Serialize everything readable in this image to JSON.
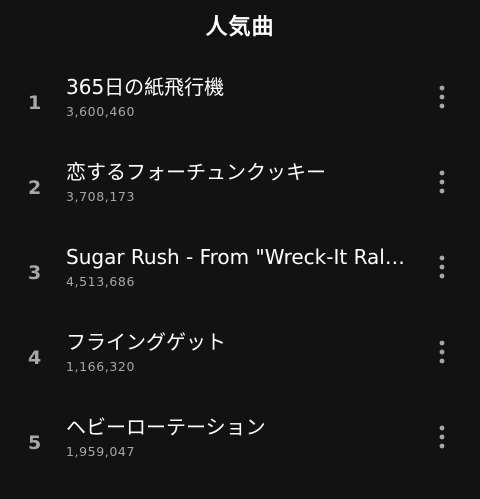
{
  "header": {
    "title": "人気曲"
  },
  "tracks": [
    {
      "rank": "1",
      "title": "365日の紙飛行機",
      "plays": "3,600,460",
      "menu_icon": "more-vertical-icon"
    },
    {
      "rank": "2",
      "title": "恋するフォーチュンクッキー",
      "plays": "3,708,173",
      "menu_icon": "more-vertical-icon"
    },
    {
      "rank": "3",
      "title": "Sugar Rush - From \"Wreck-It Ralp...",
      "plays": "4,513,686",
      "menu_icon": "more-vertical-icon"
    },
    {
      "rank": "4",
      "title": "フライングゲット",
      "plays": "1,166,320",
      "menu_icon": "more-vertical-icon"
    },
    {
      "rank": "5",
      "title": "ヘビーローテーション",
      "plays": "1,959,047",
      "menu_icon": "more-vertical-icon"
    }
  ],
  "colors": {
    "background": "#121212",
    "primary_text": "#ffffff",
    "secondary_text": "#a7a7a7"
  }
}
